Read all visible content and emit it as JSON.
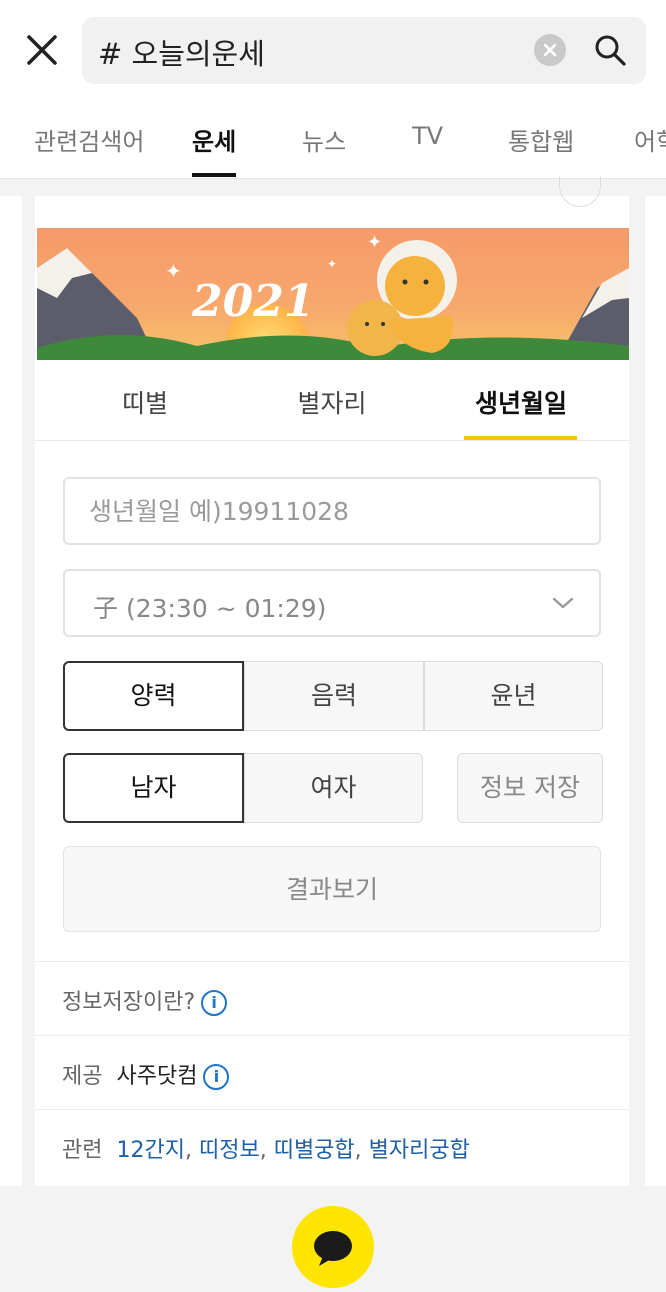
{
  "search": {
    "value": "# 오늘의운세"
  },
  "tabs": [
    {
      "label": "관련검색어",
      "active": false
    },
    {
      "label": "운세",
      "active": true
    },
    {
      "label": "뉴스",
      "active": false
    },
    {
      "label": "TV",
      "active": false
    },
    {
      "label": "통합웹",
      "active": false
    },
    {
      "label": "어학",
      "active": false
    }
  ],
  "banner": {
    "year_text": "2021"
  },
  "sub_tabs": [
    {
      "label": "띠별",
      "active": false
    },
    {
      "label": "별자리",
      "active": false
    },
    {
      "label": "생년월일",
      "active": true
    }
  ],
  "form": {
    "birthdate_placeholder": "생년월일 예)19911028",
    "time_select": "子 (23:30 ~ 01:29)",
    "calendar": [
      {
        "label": "양력",
        "selected": true
      },
      {
        "label": "음력",
        "selected": false
      },
      {
        "label": "윤년",
        "selected": false
      }
    ],
    "gender": [
      {
        "label": "남자",
        "selected": true
      },
      {
        "label": "여자",
        "selected": false
      }
    ],
    "save_label": "정보 저장",
    "result_label": "결과보기"
  },
  "info_rows": {
    "save_info": "정보저장이란?",
    "provider_label": "제공",
    "provider_value": "사주닷컴",
    "related_label": "관련",
    "related_links": [
      "12간지",
      "띠정보",
      "띠별궁합",
      "별자리궁합"
    ],
    "sep": ", "
  },
  "colors": {
    "accent": "#f5c800",
    "kakao_yellow": "#fee500",
    "link": "#1f5fa6"
  }
}
